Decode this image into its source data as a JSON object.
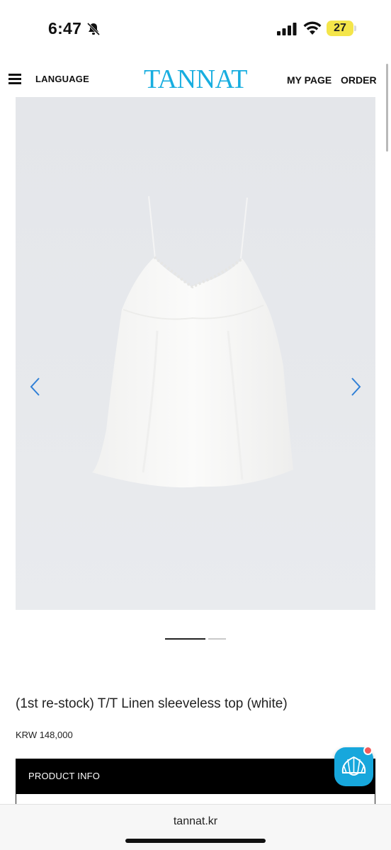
{
  "status_bar": {
    "time": "6:47",
    "battery_level": "27",
    "icons": [
      "bell-slash-icon",
      "cellular-signal-icon",
      "wifi-icon",
      "battery-icon"
    ]
  },
  "header": {
    "menu_icon": "hamburger-menu-icon",
    "language_label": "LANGUAGE",
    "logo_text": "TANNAT",
    "mypage_label": "MY PAGE",
    "order_label": "ORDER",
    "logo_color": "#18aee0"
  },
  "gallery": {
    "image_subject": "white linen camisole top",
    "prev_icon": "chevron-left-icon",
    "next_icon": "chevron-right-icon",
    "arrow_color": "#2f7fd6",
    "background_color": "#e6e8ec",
    "current_slide": 1,
    "slide_count": 2
  },
  "product": {
    "title": "(1st re-stock) T/T Linen sleeveless top (white)",
    "price": "KRW 148,000",
    "info_tab_label": "PRODUCT INFO"
  },
  "chat_button": {
    "icon": "seashell-chat-icon",
    "color": "#17a7dc",
    "notification_dot_color": "#f25a5a"
  },
  "browser": {
    "url": "tannat.kr"
  }
}
